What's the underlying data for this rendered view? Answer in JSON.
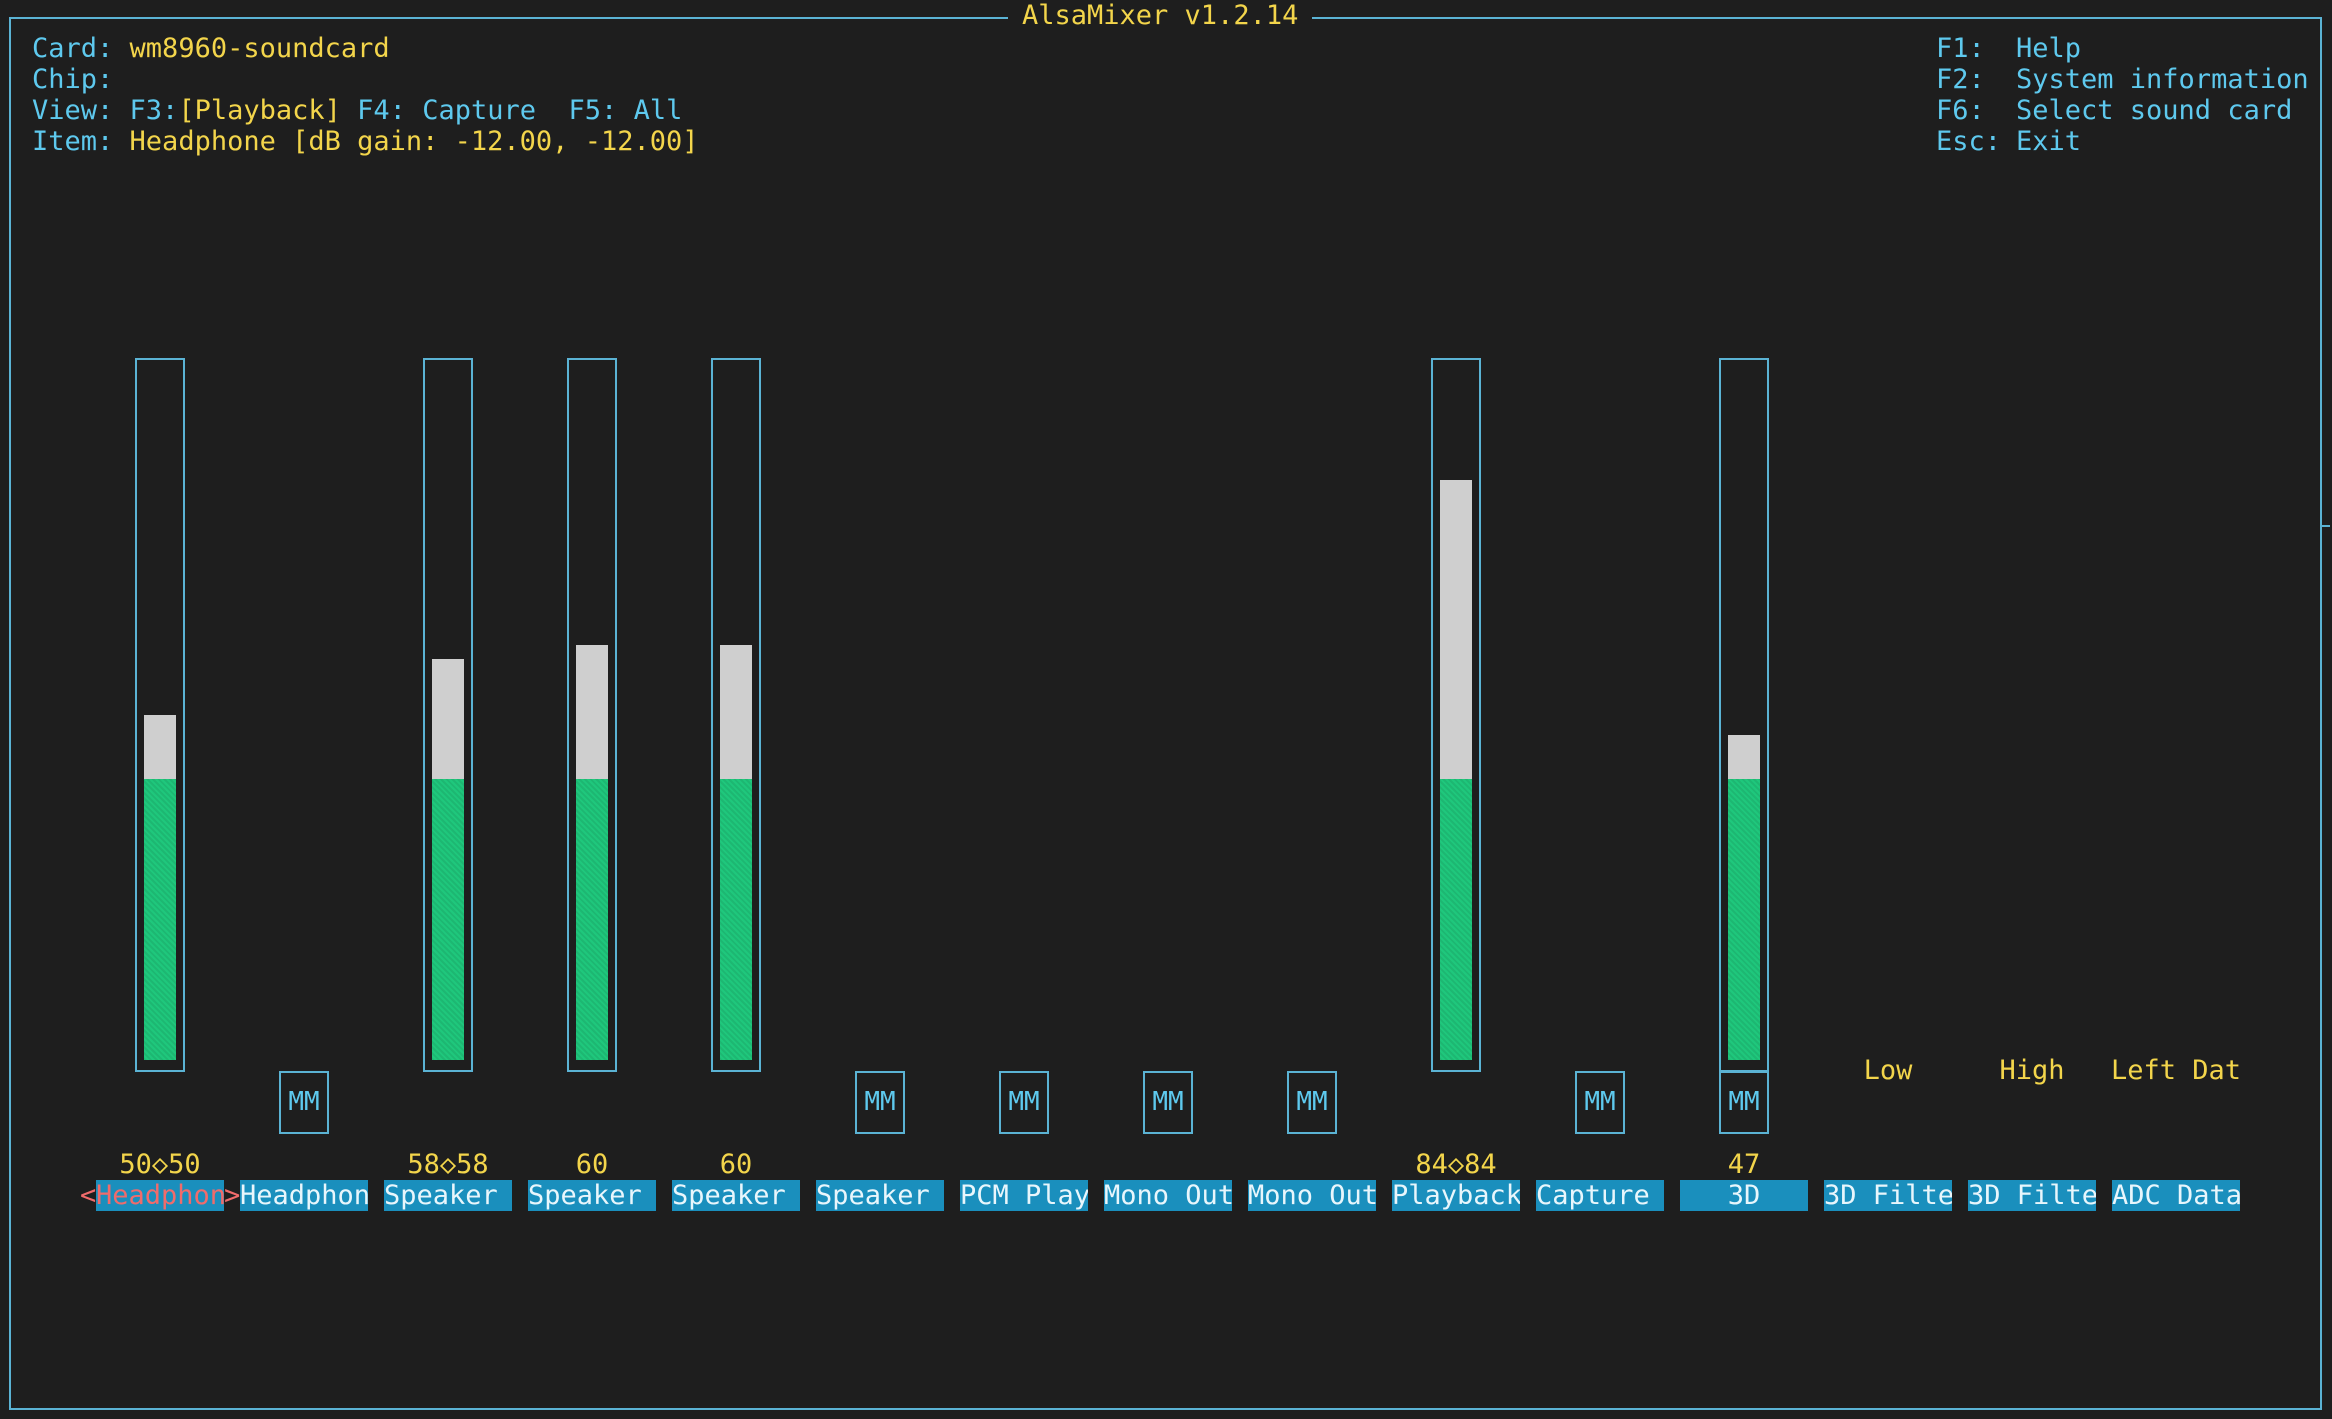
{
  "app": {
    "title": "AlsaMixer v1.2.14"
  },
  "info": {
    "card_label": "Card:",
    "card_value": "wm8960-soundcard",
    "chip_label": "Chip:",
    "chip_value": "",
    "view_label": "View:",
    "view_f3": "F3:",
    "view_playback": "[Playback]",
    "view_f4": "F4:",
    "view_capture": "Capture",
    "view_f5": "F5:",
    "view_all": "All",
    "item_label": "Item:",
    "item_value": "Headphone [dB gain: -12.00, -12.00]"
  },
  "help": [
    {
      "key": "F1:",
      "text": "Help"
    },
    {
      "key": "F2:",
      "text": "System information"
    },
    {
      "key": "F6:",
      "text": "Select sound card"
    },
    {
      "key": "Esc:",
      "text": "Exit"
    }
  ],
  "controls": [
    {
      "name": "Headphon",
      "value_text": "50<>50",
      "level": 0.5,
      "selected": true
    },
    {
      "name": "Headphon",
      "mute_label": "MM"
    },
    {
      "name": "Speaker",
      "value_text": "58<>58",
      "level": 0.58
    },
    {
      "name": "Speaker",
      "value_text": "60",
      "level": 0.6
    },
    {
      "name": "Speaker",
      "value_text": "60",
      "level": 0.6
    },
    {
      "name": "Speaker",
      "mute_label": "MM"
    },
    {
      "name": "PCM Play",
      "mute_label": "MM"
    },
    {
      "name": "Mono Out",
      "mute_label": "MM"
    },
    {
      "name": "Mono Out",
      "mute_label": "MM"
    },
    {
      "name": "Playback",
      "value_text": "84<>84",
      "level": 0.84
    },
    {
      "name": "Capture",
      "mute_label": "MM"
    },
    {
      "name": "3D",
      "value_text": "47",
      "level": 0.47,
      "mute_label": "MM"
    },
    {
      "name": "3D Filte",
      "enum_value": "Low"
    },
    {
      "name": "3D Filte",
      "enum_value": "High"
    },
    {
      "name": "ADC Data",
      "enum_value": "Left Dat"
    }
  ],
  "colors": {
    "border": "#5bb3d4",
    "label": "#5ec9ee",
    "value": "#f3d54b",
    "green": "#1fc77c",
    "red": "#f06b6b",
    "name_bg": "#1a8fbd"
  }
}
